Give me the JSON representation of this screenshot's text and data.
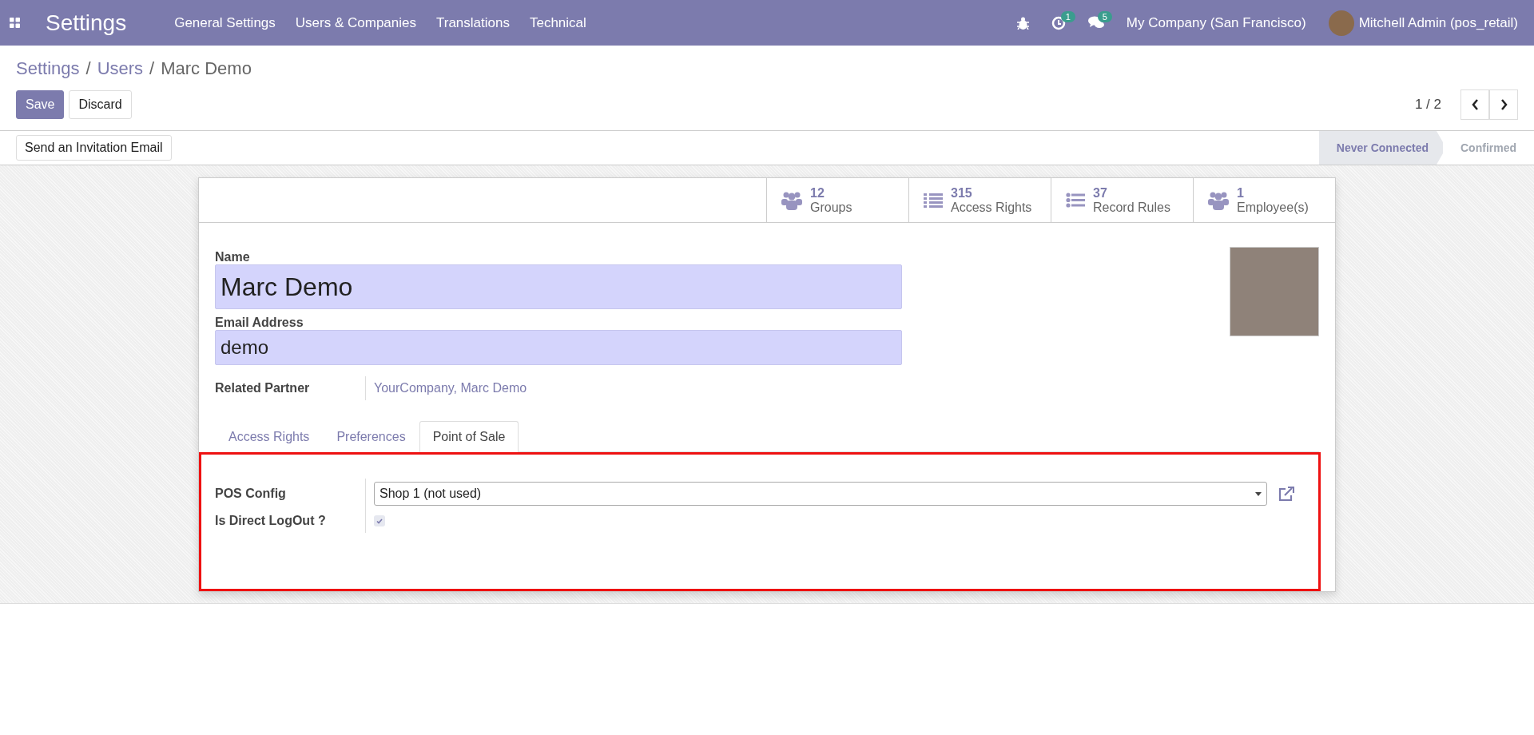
{
  "navbar": {
    "app_title": "Settings",
    "menu": [
      "General Settings",
      "Users & Companies",
      "Translations",
      "Technical"
    ],
    "activity_count": "1",
    "message_count": "5",
    "company": "My Company (San Francisco)",
    "user": "Mitchell Admin (pos_retail)"
  },
  "breadcrumb": [
    {
      "label": "Settings",
      "link": true
    },
    {
      "label": "Users",
      "link": true
    },
    {
      "label": "Marc Demo",
      "link": false
    }
  ],
  "breadcrumb_separator": "/",
  "actions": {
    "save": "Save",
    "discard": "Discard",
    "pager": "1 / 2"
  },
  "statusbar": {
    "button": "Send an Invitation Email",
    "stages": [
      {
        "label": "Never Connected",
        "selected": true
      },
      {
        "label": "Confirmed",
        "selected": false
      }
    ]
  },
  "stat_buttons": [
    {
      "kind": "users",
      "value": "12",
      "label": "Groups"
    },
    {
      "kind": "list",
      "value": "315",
      "label": "Access Rights"
    },
    {
      "kind": "bullets",
      "value": "37",
      "label": "Record Rules"
    },
    {
      "kind": "users",
      "value": "1",
      "label": "Employee(s)"
    }
  ],
  "form": {
    "name_label": "Name",
    "name": "Marc Demo",
    "email_label": "Email Address",
    "email": "demo",
    "partner_label": "Related Partner",
    "partner": "YourCompany, Marc Demo"
  },
  "tabs": [
    {
      "label": "Access Rights",
      "selected": false
    },
    {
      "label": "Preferences",
      "selected": false
    },
    {
      "label": "Point of Sale",
      "selected": true
    }
  ],
  "pos": {
    "config_label": "POS Config",
    "config_value": "Shop 1 (not used)",
    "logout_label": "Is Direct LogOut ?",
    "direct_logout": true,
    "highlighted": true
  }
}
